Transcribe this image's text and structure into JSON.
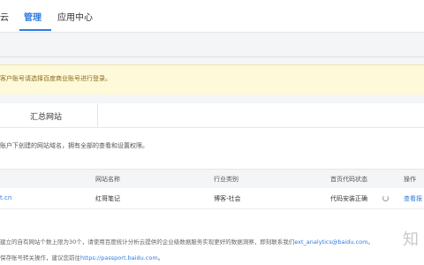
{
  "nav": {
    "item0": "云",
    "item1": "管理",
    "item2": "应用中心"
  },
  "notice": {
    "text": "客户账号请选择百度商业账号进行登录。"
  },
  "tabs": {
    "active": "汇总网站"
  },
  "description": "账户下创建的网站域名，拥有全部的查看和设置权限。",
  "table": {
    "headers": {
      "col1": "网站名称",
      "col2": "行业类别",
      "col3": "首页代码状态",
      "col4": "操作"
    },
    "row": {
      "domain": "t.cn",
      "name": "红哥笔记",
      "industry": "博客-社会",
      "code_status": "代码安装正确",
      "action": "查看报"
    }
  },
  "footer": {
    "line1_text": "建立的自有网站个数上限为30个，请使用百度统计分析云提供的企业级数据服务实现更好的数据洞察，即刻联系我们",
    "line1_email": "ext_analytics@baidu.com",
    "line1_end": "。",
    "line2_text": "保存账号转关操作，建议您前往",
    "line2_link": "https://passport.baidu.com",
    "line2_end": "。"
  },
  "watermark": "知"
}
